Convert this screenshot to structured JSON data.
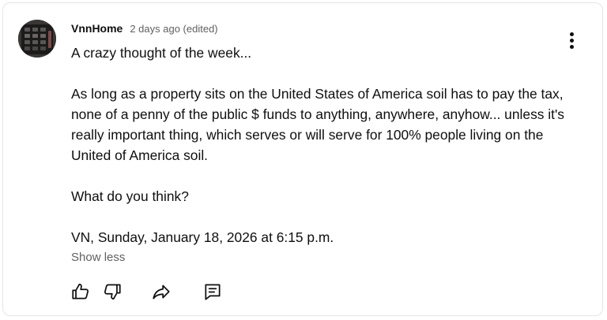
{
  "comment": {
    "author": "VnnHome",
    "time": "2 days ago (edited)",
    "paragraphs": [
      "A crazy thought of the week...",
      "As long as a property sits on the United States of America soil has to pay the tax, none of a penny of the public $ funds to anything, anywhere, anyhow... unless it's really important thing, which serves or will serve for 100% people living on the United of America soil.",
      "What do you think?",
      "VN, Sunday, January 18, 2026 at 6:15 p.m."
    ],
    "show_less": "Show less"
  },
  "icons": {
    "menu": "more-vert-icon",
    "like": "thumbs-up-icon",
    "dislike": "thumbs-down-icon",
    "share": "share-icon",
    "reply": "reply-comment-icon"
  },
  "colors": {
    "text": "#0f0f0f",
    "secondary_text": "#606060",
    "card_border": "#e5e5e5"
  }
}
